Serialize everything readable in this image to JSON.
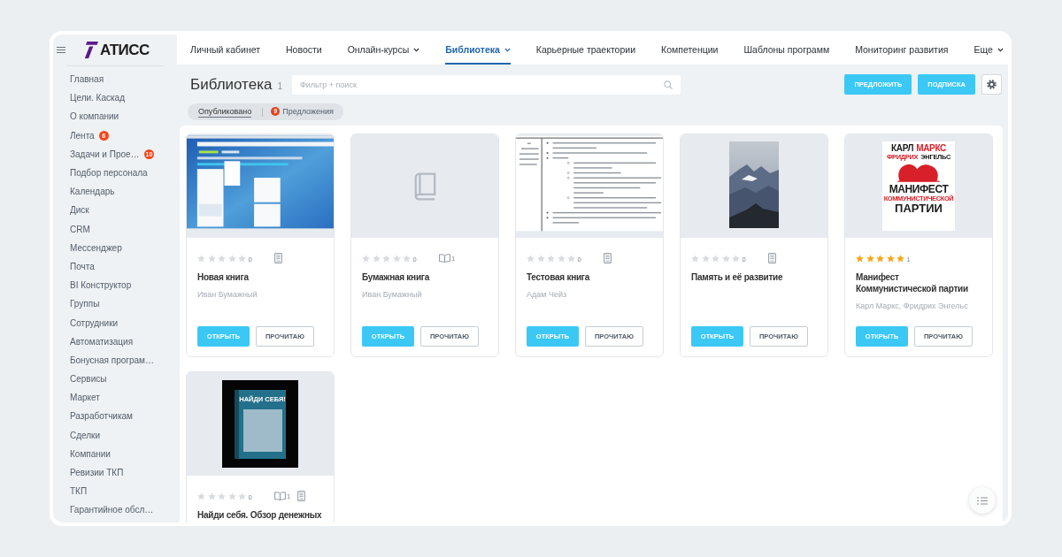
{
  "sidebar": {
    "logo": "АТИСС",
    "items": [
      {
        "label": "Главная"
      },
      {
        "label": "Цели. Каскад"
      },
      {
        "label": "О компании"
      },
      {
        "label": "Лента",
        "badge": "6"
      },
      {
        "label": "Задачи и Прое…",
        "badge": "10"
      },
      {
        "label": "Подбор персонала"
      },
      {
        "label": "Календарь"
      },
      {
        "label": "Диск"
      },
      {
        "label": "CRM"
      },
      {
        "label": "Мессенджер"
      },
      {
        "label": "Почта"
      },
      {
        "label": "BI Конструктор"
      },
      {
        "label": "Группы"
      },
      {
        "label": "Сотрудники"
      },
      {
        "label": "Автоматизация"
      },
      {
        "label": "Бонусная програм…"
      },
      {
        "label": "Сервисы"
      },
      {
        "label": "Маркет"
      },
      {
        "label": "Разработчикам"
      },
      {
        "label": "Сделки"
      },
      {
        "label": "Компании"
      },
      {
        "label": "Ревизии ТКП"
      },
      {
        "label": "ТКП"
      },
      {
        "label": "Гарантийное обсл…"
      }
    ]
  },
  "top_nav": {
    "items": [
      {
        "label": "Личный кабинет",
        "dropdown": false,
        "selected": false
      },
      {
        "label": "Новости",
        "dropdown": false,
        "selected": false
      },
      {
        "label": "Онлайн-курсы",
        "dropdown": true,
        "selected": false
      },
      {
        "label": "Библиотека",
        "dropdown": true,
        "selected": true
      },
      {
        "label": "Карьерные траектории",
        "dropdown": false,
        "selected": false
      },
      {
        "label": "Компетенции",
        "dropdown": false,
        "selected": false
      },
      {
        "label": "Шаблоны программ",
        "dropdown": false,
        "selected": false
      },
      {
        "label": "Мониторинг развития",
        "dropdown": false,
        "selected": false
      },
      {
        "label": "Еще",
        "dropdown": true,
        "selected": false
      }
    ]
  },
  "header": {
    "title": "Библиотека",
    "count": "1",
    "search": {
      "placeholder": "Фильтр + поиск"
    },
    "buttons": [
      {
        "label": "ПРЕДЛОЖИТЬ"
      },
      {
        "label": "ПОДПИСКА"
      }
    ]
  },
  "filters": [
    {
      "label": "Опубликовано",
      "selected": true
    },
    {
      "label": "Предложения",
      "badge": "9",
      "selected": false
    }
  ],
  "books": [
    {
      "cover": {
        "kind": "screenshot"
      },
      "stars": 0,
      "rating_count": "0",
      "formats": [
        {
          "kind": "ebook"
        }
      ],
      "title": "Новая книга",
      "author": "Иван Бумажный",
      "actions": [
        {
          "label": "ОТКРЫТЬ",
          "kind": "primary"
        },
        {
          "label": "ПРОЧИТАЮ",
          "kind": "secondary"
        }
      ]
    },
    {
      "cover": {
        "kind": "placeholder"
      },
      "stars": 0,
      "rating_count": "0",
      "formats": [
        {
          "kind": "paper",
          "count": "1"
        }
      ],
      "title": "Бумажная книга",
      "author": "Иван Бумажный",
      "actions": [
        {
          "label": "ОТКРЫТЬ",
          "kind": "primary"
        },
        {
          "label": "ПРОЧИТАЮ",
          "kind": "secondary"
        }
      ]
    },
    {
      "cover": {
        "kind": "document"
      },
      "stars": 0,
      "rating_count": "0",
      "formats": [
        {
          "kind": "ebook"
        }
      ],
      "title": "Тестовая книга",
      "author": "Адам Чейз",
      "actions": [
        {
          "label": "ОТКРЫТЬ",
          "kind": "primary"
        },
        {
          "label": "ПРОЧИТАЮ",
          "kind": "secondary"
        }
      ]
    },
    {
      "cover": {
        "kind": "photo"
      },
      "stars": 0,
      "rating_count": "0",
      "formats": [
        {
          "kind": "ebook"
        }
      ],
      "title": "Память и её развитие",
      "actions": [
        {
          "label": "ОТКРЫТЬ",
          "kind": "primary"
        },
        {
          "label": "ПРОЧИТАЮ",
          "kind": "secondary"
        }
      ]
    },
    {
      "cover": {
        "kind": "poster",
        "top_lines": [
          {
            "words": [
              {
                "text": "КАРЛ",
                "color": "#1b1b1b"
              },
              {
                "text": "МАРКС",
                "color": "#d7202a"
              }
            ]
          },
          {
            "words": [
              {
                "text": "ФРИДРИХ",
                "color": "#d7202a"
              },
              {
                "text": "ЭНГЕЛЬС",
                "color": "#1b1b1b"
              }
            ]
          }
        ],
        "bottom_lines": [
          {
            "words": [
              {
                "text": "МАНИФЕСТ",
                "color": "#1b1b1b"
              }
            ]
          },
          {
            "words": [
              {
                "text": "КОММУНИСТИЧЕСКОЙ",
                "color": "#d7202a"
              }
            ]
          },
          {
            "words": [
              {
                "text": "ПАРТИИ",
                "color": "#1b1b1b"
              }
            ]
          }
        ]
      },
      "stars": 5,
      "rating_count": "1",
      "title": "Манифест Коммунистической партии",
      "author": "Карл Маркс, Фридрих Энгельс",
      "actions": [
        {
          "label": "ОТКРЫТЬ",
          "kind": "primary"
        },
        {
          "label": "ПРОЧИТАЮ",
          "kind": "secondary"
        }
      ]
    },
    {
      "cover": {
        "kind": "boxed_book",
        "title": "НАЙДИ СЕБЯ!"
      },
      "stars": 0,
      "rating_count": "0",
      "formats": [
        {
          "kind": "paper",
          "count": "1"
        },
        {
          "kind": "ebook"
        }
      ],
      "title": "Найди себя. Обзор денежных"
    }
  ]
}
